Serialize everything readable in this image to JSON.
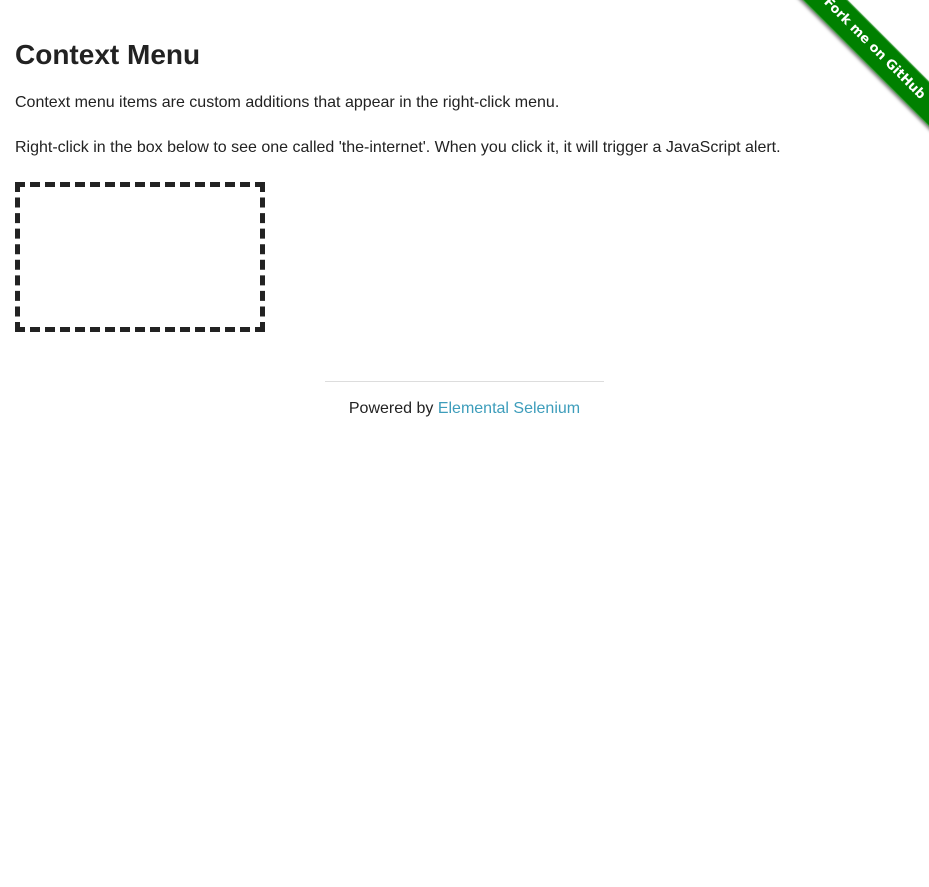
{
  "page": {
    "title": "Context Menu",
    "paragraphs": [
      "Context menu items are custom additions that appear in the right-click menu.",
      "Right-click in the box below to see one called 'the-internet'. When you click it, it will trigger a JavaScript alert."
    ]
  },
  "ribbon": {
    "label": "Fork me on GitHub",
    "color": "#008000"
  },
  "footer": {
    "prefix": "Powered by ",
    "link_label": "Elemental Selenium",
    "link_color": "#3d9dbb"
  }
}
